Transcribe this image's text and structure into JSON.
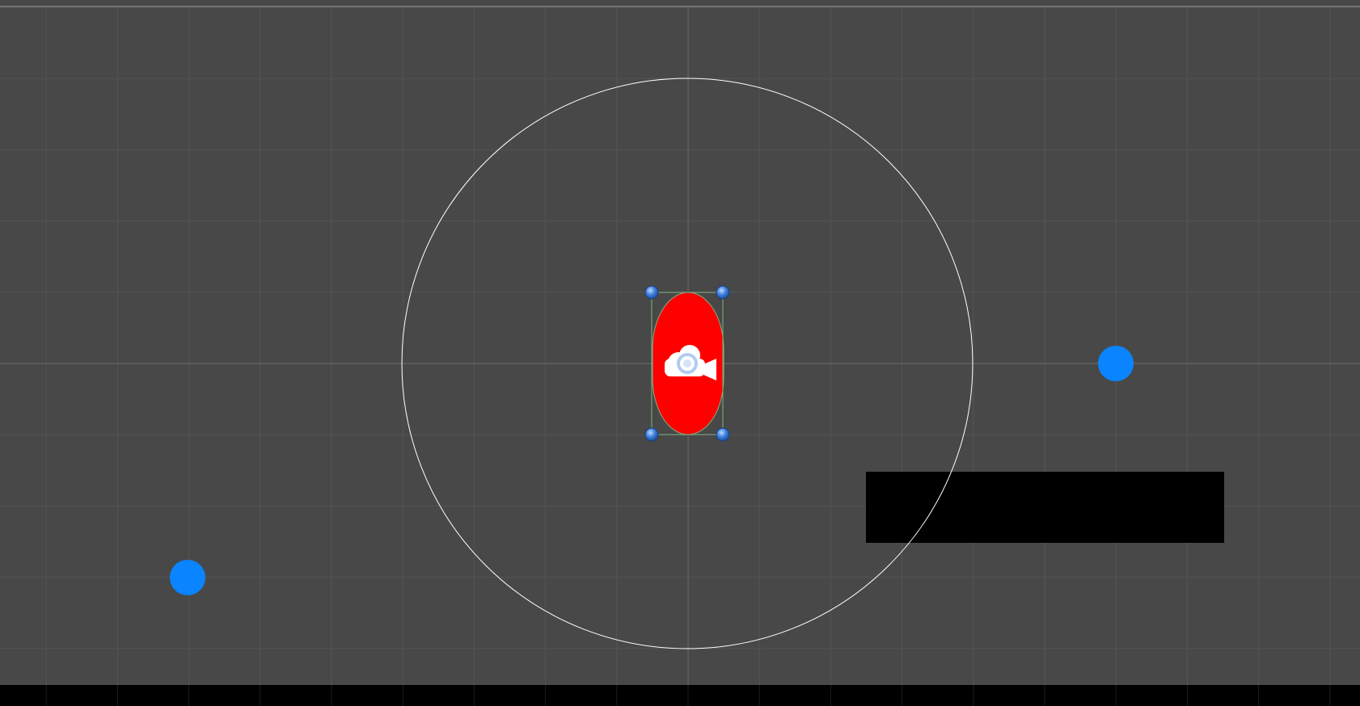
{
  "scene_view": {
    "background_color": "#484848",
    "grid_color": "#545454",
    "axis_color": "#6a6a6a",
    "top_border_color": "#9a9a9a",
    "bottom_bar_color": "#000000"
  },
  "objects": {
    "radius_circle": {
      "stroke_color": "#ffffff"
    },
    "player_capsule": {
      "fill_color": "#ff0000",
      "bounds_color": "#7fb07f"
    },
    "camera_gizmo": {
      "icon": "camera-icon",
      "color": "#ffffff"
    },
    "pivot_gizmo": {
      "icon": "pivot-icon",
      "color": "#a9c6f0"
    },
    "rect_handles": {
      "icon": "handle-dot-icon",
      "color": "#2f6fd1"
    },
    "collectible_dots": {
      "fill_color": "#0a84ff"
    },
    "platform_block": {
      "fill_color": "#000000"
    }
  }
}
